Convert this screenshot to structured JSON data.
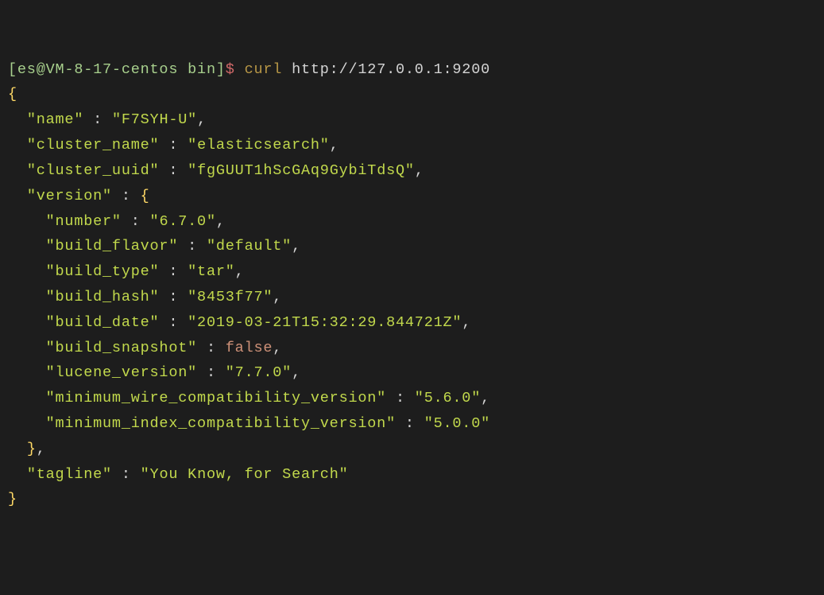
{
  "prompt": {
    "user_host": "[es@VM-8-17-centos bin]",
    "dollar": "$",
    "command": "curl",
    "url": "http://127.0.0.1:9200"
  },
  "keys": {
    "name": "\"name\"",
    "cluster_name": "\"cluster_name\"",
    "cluster_uuid": "\"cluster_uuid\"",
    "version": "\"version\"",
    "number": "\"number\"",
    "build_flavor": "\"build_flavor\"",
    "build_type": "\"build_type\"",
    "build_hash": "\"build_hash\"",
    "build_date": "\"build_date\"",
    "build_snapshot": "\"build_snapshot\"",
    "lucene_version": "\"lucene_version\"",
    "min_wire": "\"minimum_wire_compatibility_version\"",
    "min_index": "\"minimum_index_compatibility_version\"",
    "tagline": "\"tagline\""
  },
  "vals": {
    "name": "\"F7SYH-U\"",
    "cluster_name": "\"elasticsearch\"",
    "cluster_uuid": "\"fgGUUT1hScGAq9GybiTdsQ\"",
    "number": "\"6.7.0\"",
    "build_flavor": "\"default\"",
    "build_type": "\"tar\"",
    "build_hash": "\"8453f77\"",
    "build_date": "\"2019-03-21T15:32:29.844721Z\"",
    "build_snapshot": "false",
    "lucene_version": "\"7.7.0\"",
    "min_wire": "\"5.6.0\"",
    "min_index": "\"5.0.0\"",
    "tagline": "\"You Know, for Search\""
  },
  "punct": {
    "colon_sp": " : ",
    "comma": ",",
    "open": "{",
    "close": "}"
  }
}
